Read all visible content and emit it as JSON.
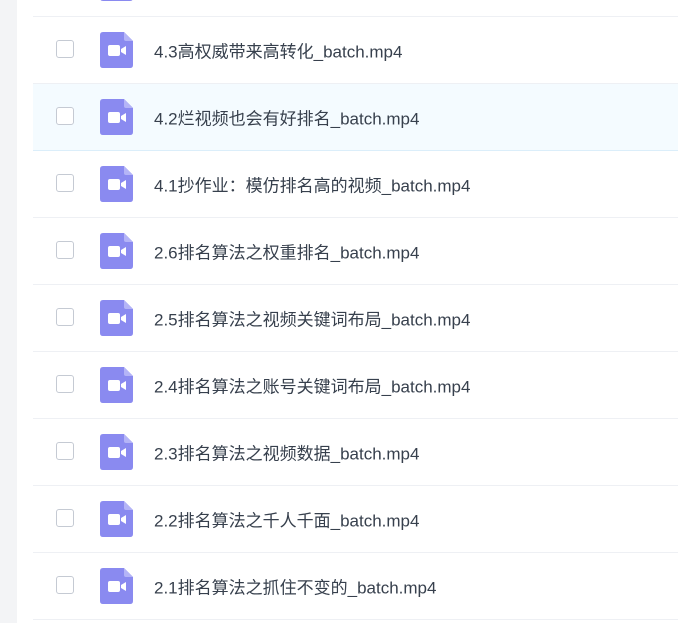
{
  "file_list": {
    "accent_color": "#8a8af0",
    "items": [
      {
        "name": "",
        "icon": "video-file-icon",
        "selected": false
      },
      {
        "name": "4.3高权威带来高转化_batch.mp4",
        "icon": "video-file-icon",
        "selected": false
      },
      {
        "name": "4.2烂视频也会有好排名_batch.mp4",
        "icon": "video-file-icon",
        "selected": false
      },
      {
        "name": "4.1抄作业：模仿排名高的视频_batch.mp4",
        "icon": "video-file-icon",
        "selected": false
      },
      {
        "name": "2.6排名算法之权重排名_batch.mp4",
        "icon": "video-file-icon",
        "selected": false
      },
      {
        "name": "2.5排名算法之视频关键词布局_batch.mp4",
        "icon": "video-file-icon",
        "selected": false
      },
      {
        "name": "2.4排名算法之账号关键词布局_batch.mp4",
        "icon": "video-file-icon",
        "selected": false
      },
      {
        "name": "2.3排名算法之视频数据_batch.mp4",
        "icon": "video-file-icon",
        "selected": false
      },
      {
        "name": "2.2排名算法之千人千面_batch.mp4",
        "icon": "video-file-icon",
        "selected": false
      },
      {
        "name": "2.1排名算法之抓住不变的_batch.mp4",
        "icon": "video-file-icon",
        "selected": false
      }
    ]
  }
}
